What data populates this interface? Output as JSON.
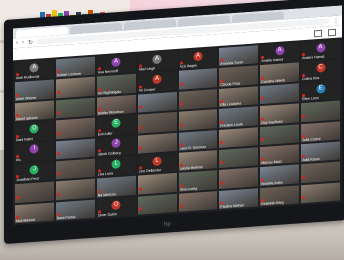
{
  "browser": {
    "tabs": [
      "",
      "",
      "",
      "",
      "",
      ""
    ],
    "url": ""
  },
  "bezel_logo": "hp",
  "meeting": {
    "tiles": [
      {
        "name": "Ariel Rudkovsk",
        "initial": "A",
        "color": "#7a7a7a",
        "video": false
      },
      {
        "name": "Ashish Loshore",
        "initial": "",
        "color": "",
        "video": true
      },
      {
        "name": "Asa Nemiroff",
        "initial": "A",
        "color": "#8e44ad",
        "video": false
      },
      {
        "name": "Abel Leigh",
        "initial": "A",
        "color": "#7a7a7a",
        "video": false
      },
      {
        "name": "Azzi Bagim",
        "initial": "A",
        "color": "#c0392b",
        "video": false
      },
      {
        "name": "Amanda Turen",
        "initial": "",
        "color": "",
        "video": true
      },
      {
        "name": "Amélie Hamid",
        "initial": "A",
        "color": "#8e44ad",
        "video": false
      },
      {
        "name": "Anders Hamid",
        "initial": "A",
        "color": "#8e44ad",
        "video": false
      },
      {
        "name": "Arieh Wiener",
        "initial": "",
        "color": "",
        "video": true
      },
      {
        "name": "",
        "initial": "",
        "color": "",
        "video": true
      },
      {
        "name": "Avi Nightingale",
        "initial": "",
        "color": "",
        "video": true
      },
      {
        "name": "Ari Cooper",
        "initial": "A",
        "color": "#c0392b",
        "video": false
      },
      {
        "name": "",
        "initial": "",
        "color": "",
        "video": true
      },
      {
        "name": "Claude Prinz",
        "initial": "",
        "color": "",
        "video": true
      },
      {
        "name": "Caroline Weinb",
        "initial": "",
        "color": "",
        "video": true
      },
      {
        "name": "Colina Kira",
        "initial": "C",
        "color": "#c0392b",
        "video": false
      },
      {
        "name": "David Iglesias",
        "initial": "",
        "color": "",
        "video": true
      },
      {
        "name": "",
        "initial": "",
        "color": "",
        "video": true
      },
      {
        "name": "Dobbs Woodrow",
        "initial": "",
        "color": "",
        "video": true
      },
      {
        "name": "",
        "initial": "",
        "color": "",
        "video": true
      },
      {
        "name": "",
        "initial": "",
        "color": "",
        "video": true
      },
      {
        "name": "Ella Lindqvist",
        "initial": "",
        "color": "",
        "video": true
      },
      {
        "name": "",
        "initial": "",
        "color": "",
        "video": true
      },
      {
        "name": "Ellen Leno",
        "initial": "E",
        "color": "#2980b9",
        "video": false
      },
      {
        "name": "Dani Naimi",
        "initial": "D",
        "color": "#27ae60",
        "video": false
      },
      {
        "name": "",
        "initial": "",
        "color": "",
        "video": true
      },
      {
        "name": "Esti Adler",
        "initial": "E",
        "color": "#27ae60",
        "video": false
      },
      {
        "name": "",
        "initial": "",
        "color": "",
        "video": true
      },
      {
        "name": "",
        "initial": "",
        "color": "",
        "video": true
      },
      {
        "name": "Frédéric Lindh",
        "initial": "",
        "color": "",
        "video": true
      },
      {
        "name": "Guy Kaufman",
        "initial": "",
        "color": "",
        "video": true
      },
      {
        "name": "",
        "initial": "",
        "color": "",
        "video": true
      },
      {
        "name": "Iris",
        "initial": "I",
        "color": "#8e44ad",
        "video": false
      },
      {
        "name": "",
        "initial": "",
        "color": "",
        "video": true
      },
      {
        "name": "Jakob Golberg",
        "initial": "J",
        "color": "#8e44ad",
        "video": false
      },
      {
        "name": "",
        "initial": "",
        "color": "",
        "video": true
      },
      {
        "name": "Leon R. Sommer",
        "initial": "",
        "color": "",
        "video": true
      },
      {
        "name": "",
        "initial": "",
        "color": "",
        "video": true
      },
      {
        "name": "",
        "initial": "",
        "color": "",
        "video": true
      },
      {
        "name": "Julia Czerni",
        "initial": "",
        "color": "",
        "video": true
      },
      {
        "name": "Jonathan Fenz",
        "initial": "J",
        "color": "#27ae60",
        "video": false
      },
      {
        "name": "",
        "initial": "",
        "color": "",
        "video": true
      },
      {
        "name": "Lisa Luna",
        "initial": "L",
        "color": "#27ae60",
        "video": false
      },
      {
        "name": "Lino Dellander",
        "initial": "L",
        "color": "#c0392b",
        "video": false
      },
      {
        "name": "Leonie Berliner",
        "initial": "",
        "color": "",
        "video": true
      },
      {
        "name": "",
        "initial": "",
        "color": "",
        "video": true
      },
      {
        "name": "Marcus Mazz",
        "initial": "",
        "color": "",
        "video": true
      },
      {
        "name": "Julia Raum",
        "initial": "",
        "color": "",
        "video": true
      },
      {
        "name": "",
        "initial": "",
        "color": "",
        "video": true
      },
      {
        "name": "",
        "initial": "",
        "color": "",
        "video": true
      },
      {
        "name": "Na Wortuss",
        "initial": "",
        "color": "",
        "video": true
      },
      {
        "name": "",
        "initial": "",
        "color": "",
        "video": true
      },
      {
        "name": "Nina Lustig",
        "initial": "",
        "color": "",
        "video": true
      },
      {
        "name": "",
        "initial": "",
        "color": "",
        "video": true
      },
      {
        "name": "Nordine Adiss",
        "initial": "",
        "color": "",
        "video": true
      },
      {
        "name": "",
        "initial": "",
        "color": "",
        "video": true
      },
      {
        "name": "Noa Manoel",
        "initial": "",
        "color": "",
        "video": true
      },
      {
        "name": "Nora Partos",
        "initial": "",
        "color": "",
        "video": true
      },
      {
        "name": "Omer Guttin",
        "initial": "O",
        "color": "#c0392b",
        "video": false
      },
      {
        "name": "",
        "initial": "",
        "color": "",
        "video": true
      },
      {
        "name": "",
        "initial": "",
        "color": "",
        "video": true
      },
      {
        "name": "Pauline Nathan",
        "initial": "",
        "color": "",
        "video": true
      },
      {
        "name": "Rebekah Berg",
        "initial": "",
        "color": "",
        "video": true
      },
      {
        "name": "",
        "initial": "",
        "color": "",
        "video": true
      }
    ]
  }
}
